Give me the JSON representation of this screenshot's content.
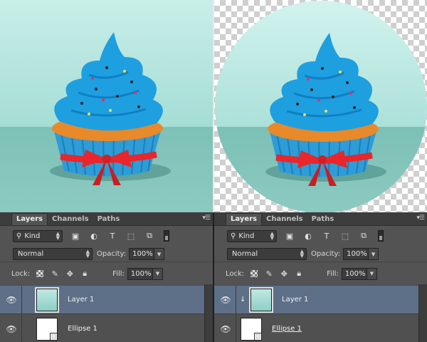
{
  "panels": [
    {
      "tabs": [
        "Layers",
        "Channels",
        "Paths"
      ],
      "active_tab": "Layers",
      "menu_icon": "panel-menu-icon",
      "filter_kind": "Kind",
      "blend_mode": "Normal",
      "opacity_label": "Opacity:",
      "opacity_value": "100%",
      "lock_label": "Lock:",
      "fill_label": "Fill:",
      "fill_value": "100%",
      "layers": [
        {
          "name": "Layer 1",
          "selected": true,
          "clipped": false
        },
        {
          "name": "Ellipse 1",
          "selected": false,
          "clipped": false
        }
      ]
    },
    {
      "tabs": [
        "Layers",
        "Channels",
        "Paths"
      ],
      "active_tab": "Layers",
      "menu_icon": "panel-menu-icon",
      "filter_kind": "Kind",
      "blend_mode": "Normal",
      "opacity_label": "Opacity:",
      "opacity_value": "100%",
      "lock_label": "Lock:",
      "fill_label": "Fill:",
      "fill_value": "100%",
      "layers": [
        {
          "name": "Layer 1",
          "selected": true,
          "clipped": true
        },
        {
          "name": "Ellipse 1",
          "selected": false,
          "clipped": false
        }
      ]
    }
  ],
  "colors": {
    "frosting": "#1e9fe0",
    "liner": "#2e9cd6",
    "ribbon": "#e8262c",
    "cake": "#e8892a",
    "selection": "#5e6f88"
  }
}
